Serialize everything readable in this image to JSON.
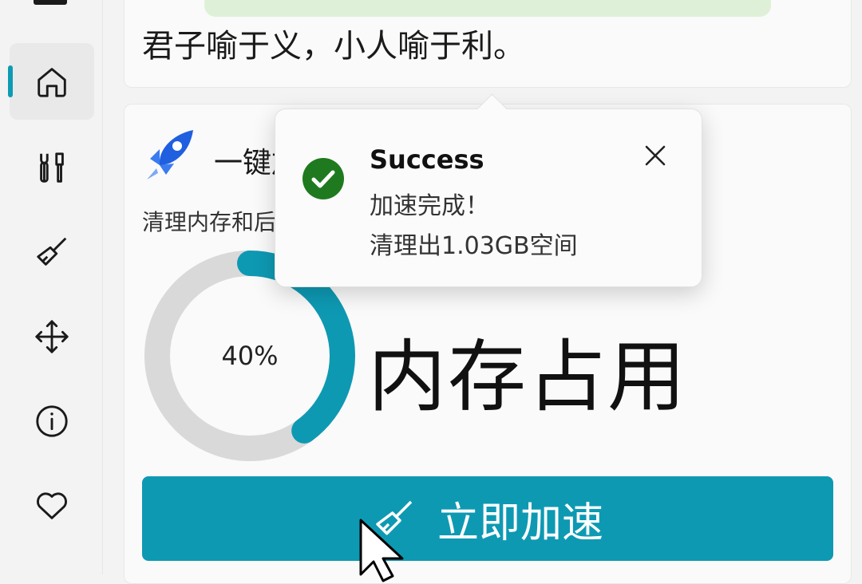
{
  "quote": {
    "text": "君子喻于义，小人喻于利。"
  },
  "accelerate_card": {
    "title": "一键加速",
    "subtitle": "清理内存和后台",
    "memory_gauge": {
      "value": 0.4,
      "label": "40%"
    },
    "memory_label": "内存占用",
    "button_label": "立即加速"
  },
  "toast": {
    "title": "Success",
    "line1": "加速完成！",
    "line2": "清理出1.03GB空间",
    "status_icon": "check-circle-icon"
  },
  "sidebar": {
    "items": [
      {
        "icon": "home-icon",
        "active": true
      },
      {
        "icon": "tools-icon"
      },
      {
        "icon": "broom-icon"
      },
      {
        "icon": "move-icon"
      },
      {
        "icon": "info-icon"
      },
      {
        "icon": "heart-icon"
      }
    ]
  },
  "colors": {
    "accent": "#0e99b3",
    "gauge_track": "#d9d9d9",
    "success": "#1f7a1f",
    "quote_bar": "#dff0d8"
  }
}
